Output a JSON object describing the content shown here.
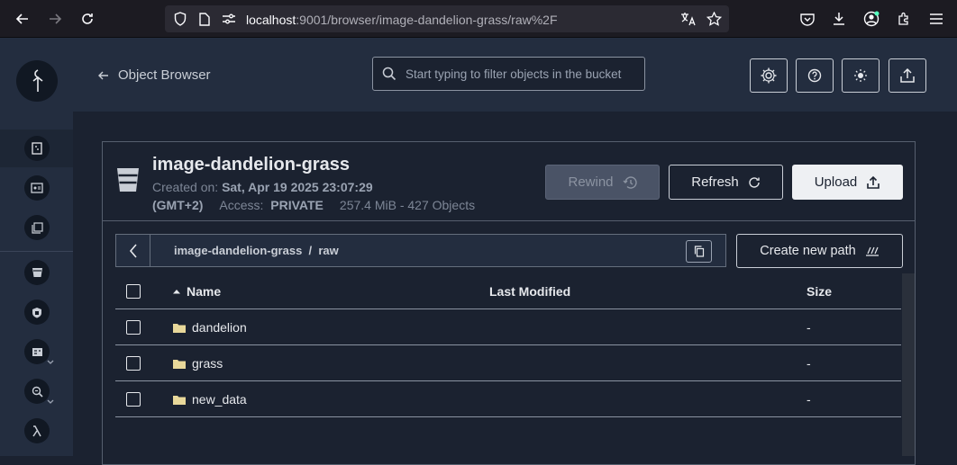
{
  "browser": {
    "url_host": "localhost",
    "url_rest": ":9001/browser/image-dandelion-grass/raw%2F"
  },
  "header": {
    "back_label": "Object Browser",
    "search_placeholder": "Start typing to filter objects in the bucket"
  },
  "bucket": {
    "name": "image-dandelion-grass",
    "created_label": "Created on:",
    "created_value": "Sat, Apr 19 2025 23:07:29",
    "timezone": "(GMT+2)",
    "access_label": "Access:",
    "access_value": "PRIVATE",
    "usage": "257.4 MiB - 427 Objects"
  },
  "actions": {
    "rewind": "Rewind",
    "refresh": "Refresh",
    "upload": "Upload",
    "create_path": "Create new path"
  },
  "path": {
    "text": "image-dandelion-grass  /  raw"
  },
  "table": {
    "headers": {
      "name": "Name",
      "modified": "Last Modified",
      "size": "Size"
    },
    "rows": [
      {
        "name": "dandelion",
        "modified": "",
        "size": "-"
      },
      {
        "name": "grass",
        "modified": "",
        "size": "-"
      },
      {
        "name": "new_data",
        "modified": "",
        "size": "-"
      }
    ]
  },
  "colors": {
    "background": "#1b2230",
    "panel": "#232d3f",
    "folder": "#e8d89a"
  }
}
